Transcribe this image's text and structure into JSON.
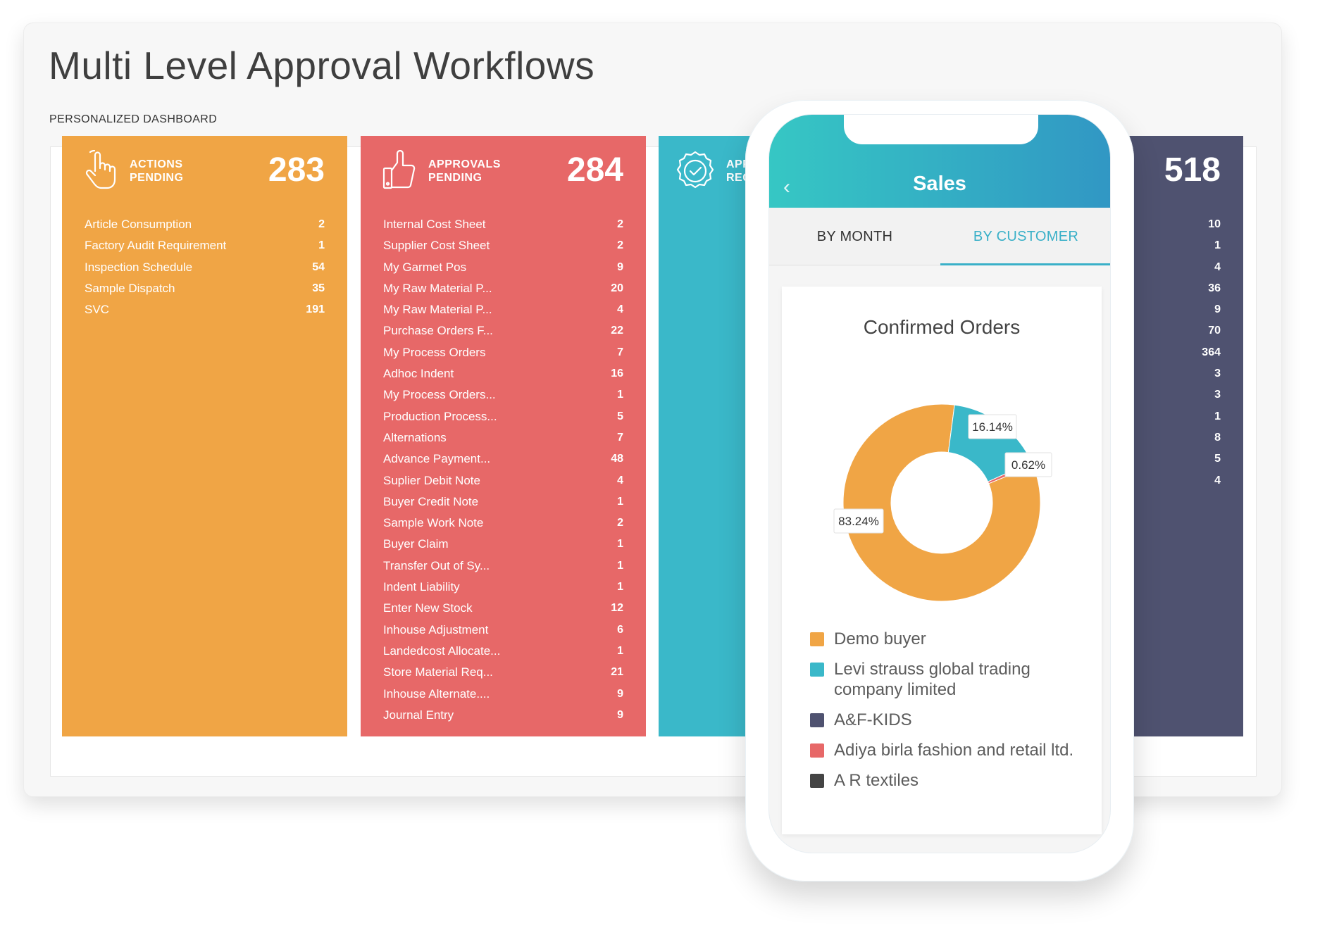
{
  "page": {
    "title": "Multi Level Approval Workflows",
    "subtitle": "PERSONALIZED DASHBOARD"
  },
  "cards": {
    "actions": {
      "heading_line1": "ACTIONS",
      "heading_line2": "PENDING",
      "total": "283",
      "icon": "pointing-hand-icon",
      "color": "#f0a545",
      "rows": [
        {
          "label": "Article Consumption",
          "value": "2"
        },
        {
          "label": "Factory Audit Requirement",
          "value": "1"
        },
        {
          "label": "Inspection Schedule",
          "value": "54"
        },
        {
          "label": "Sample Dispatch",
          "value": "35"
        },
        {
          "label": "SVC",
          "value": "191"
        }
      ]
    },
    "approvals": {
      "heading_line1": "APPROVALS",
      "heading_line2": "PENDING",
      "total": "284",
      "icon": "thumbs-up-icon",
      "color": "#e76868",
      "rows": [
        {
          "label": "Internal Cost Sheet",
          "value": "2"
        },
        {
          "label": "Supplier Cost Sheet",
          "value": "2"
        },
        {
          "label": "My Garmet Pos",
          "value": "9"
        },
        {
          "label": "My Raw Material P...",
          "value": "20"
        },
        {
          "label": "My Raw Material P...",
          "value": "4"
        },
        {
          "label": "Purchase Orders F...",
          "value": "22"
        },
        {
          "label": "My Process Orders",
          "value": "7"
        },
        {
          "label": "Adhoc Indent",
          "value": "16"
        },
        {
          "label": "My Process Orders...",
          "value": "1"
        },
        {
          "label": "Production Process...",
          "value": "5"
        },
        {
          "label": "Alternations",
          "value": "7"
        },
        {
          "label": "Advance Payment...",
          "value": "48"
        },
        {
          "label": "Suplier Debit Note",
          "value": "4"
        },
        {
          "label": "Buyer Credit Note",
          "value": "1"
        },
        {
          "label": "Sample Work Note",
          "value": "2"
        },
        {
          "label": "Buyer Claim",
          "value": "1"
        },
        {
          "label": "Transfer Out of Sy...",
          "value": "1"
        },
        {
          "label": "Indent Liability",
          "value": "1"
        },
        {
          "label": "Enter New Stock",
          "value": "12"
        },
        {
          "label": "Inhouse Adjustment",
          "value": "6"
        },
        {
          "label": "Landedcost Allocate...",
          "value": "1"
        },
        {
          "label": "Store Material Req...",
          "value": "21"
        },
        {
          "label": "Inhouse Alternate....",
          "value": "9"
        },
        {
          "label": "Journal Entry",
          "value": "9"
        }
      ]
    },
    "approved": {
      "heading_line1": "APP",
      "heading_line2": "REQ",
      "icon": "check-badge-icon",
      "color": "#3ab8c9"
    },
    "dark": {
      "total": "518",
      "color": "#4f5270",
      "rows": [
        {
          "value": "10"
        },
        {
          "value": "1"
        },
        {
          "value": "4"
        },
        {
          "value": "36"
        },
        {
          "value": "9"
        },
        {
          "value": "70"
        },
        {
          "value": "364"
        },
        {
          "value": "3"
        },
        {
          "value": "3"
        },
        {
          "value": "1"
        },
        {
          "value": "8"
        },
        {
          "value": "5"
        },
        {
          "value": "4"
        }
      ]
    }
  },
  "phone": {
    "title": "Sales",
    "back_icon": "chevron-left-icon",
    "tabs": {
      "by_month": "BY MONTH",
      "by_customer": "BY CUSTOMER",
      "active": "by_customer"
    }
  },
  "chart_data": {
    "type": "pie",
    "title": "Confirmed Orders",
    "donut": true,
    "slices": [
      {
        "name": "Demo buyer",
        "value": 83.24,
        "label": "83.24%",
        "color": "#f0a545"
      },
      {
        "name": "Levi strauss global trading company limited",
        "value": 16.14,
        "label": "16.14%",
        "color": "#3ab8c9"
      },
      {
        "name": "Adiya birla fashion and retail ltd.",
        "value": 0.62,
        "label": "0.62%",
        "color": "#e76868"
      }
    ],
    "legend": [
      {
        "name": "Demo buyer",
        "color": "#f0a545"
      },
      {
        "name": "Levi strauss global trading company limited",
        "color": "#3ab8c9"
      },
      {
        "name": "A&F-KIDS",
        "color": "#4f5270"
      },
      {
        "name": "Adiya birla fashion and retail ltd.",
        "color": "#e76868"
      },
      {
        "name": "A R textiles",
        "color": "#444444"
      }
    ],
    "legend_position": "bottom"
  }
}
